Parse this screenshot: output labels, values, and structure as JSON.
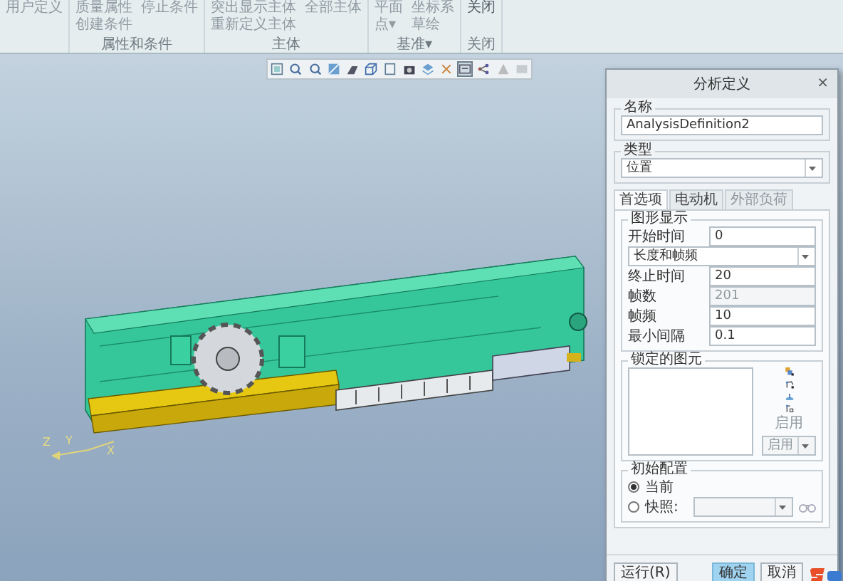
{
  "ribbon": {
    "groups": [
      {
        "items": [
          {
            "label": "用户定义",
            "disabled": true
          }
        ]
      },
      {
        "label": "属性和条件",
        "items": [
          {
            "label": "质量属性",
            "disabled": true
          },
          {
            "label": "创建条件",
            "disabled": true
          },
          {
            "label": "停止条件",
            "disabled": true
          }
        ]
      },
      {
        "label": "主体",
        "items": [
          {
            "label": "突出显示主体",
            "disabled": true
          },
          {
            "label": "重新定义主体",
            "disabled": true
          },
          {
            "label": "全部主体",
            "disabled": true
          }
        ]
      },
      {
        "label": "基准▾",
        "items": [
          {
            "label": "平面",
            "disabled": true
          },
          {
            "label": "点▾",
            "disabled": true
          },
          {
            "label": "坐标系",
            "disabled": true
          },
          {
            "label": "草绘",
            "disabled": true
          }
        ]
      },
      {
        "label": "关闭",
        "items": [
          {
            "label": "关闭",
            "disabled": false
          }
        ]
      }
    ]
  },
  "view_toolbar": {
    "buttons": [
      {
        "selected": false
      },
      {
        "selected": false
      },
      {
        "selected": false
      },
      {
        "selected": false
      },
      {
        "selected": false
      },
      {
        "selected": false
      },
      {
        "selected": false
      },
      {
        "selected": false
      },
      {
        "selected": false
      },
      {
        "selected": false
      },
      {
        "selected": true
      },
      {
        "selected": false
      },
      {
        "selected": false
      },
      {
        "selected": false
      }
    ]
  },
  "triad": {
    "labels": [
      "Z",
      "Y",
      "X"
    ]
  },
  "dialog": {
    "title": "分析定义",
    "close": "×",
    "name_section": {
      "label": "名称",
      "value": "AnalysisDefinition2"
    },
    "type_section": {
      "label": "类型",
      "value": "位置"
    },
    "tabs": [
      {
        "label": "首选项",
        "selected": true,
        "disabled": false
      },
      {
        "label": "电动机",
        "selected": false,
        "disabled": false
      },
      {
        "label": "外部负荷",
        "selected": false,
        "disabled": true
      }
    ],
    "graphic_display": {
      "label": "图形显示",
      "rows": [
        {
          "kind": "field",
          "label": "开始时间",
          "value": "0",
          "disabled": false
        },
        {
          "kind": "select",
          "value": "长度和帧频"
        },
        {
          "kind": "field",
          "label": "终止时间",
          "value": "20",
          "disabled": false
        },
        {
          "kind": "field",
          "label": "帧数",
          "value": "201",
          "disabled": true
        },
        {
          "kind": "field",
          "label": "帧频",
          "value": "10",
          "disabled": false
        },
        {
          "kind": "field",
          "label": "最小间隔",
          "value": "0.1",
          "disabled": false
        }
      ]
    },
    "locked_entities": {
      "label": "锁定的图元",
      "enable_label": "启用",
      "enable_value": "启用"
    },
    "initial_config": {
      "label": "初始配置",
      "options": [
        {
          "label": "当前",
          "selected": true
        },
        {
          "label": "快照:",
          "selected": false
        }
      ]
    },
    "buttons": [
      {
        "label": "运行(R)",
        "kind": "default"
      },
      {
        "label": "确定",
        "kind": "primary"
      },
      {
        "label": "取消",
        "kind": "default"
      }
    ]
  }
}
